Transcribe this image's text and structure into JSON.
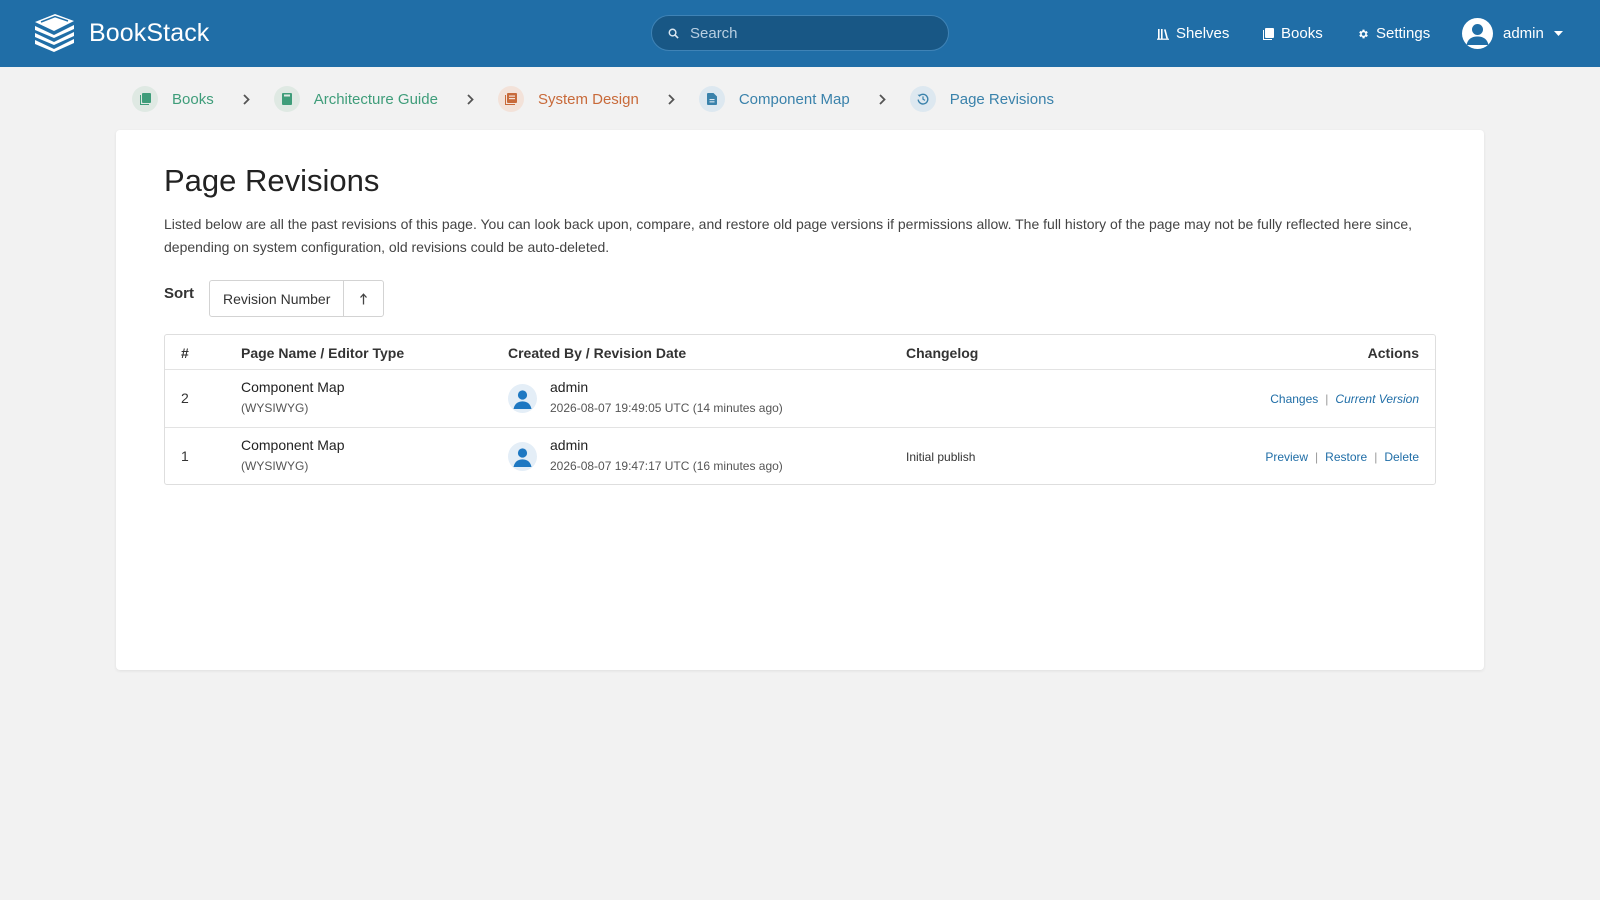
{
  "header": {
    "app_name": "BookStack",
    "search_placeholder": "Search",
    "nav": {
      "shelves": "Shelves",
      "books": "Books",
      "settings": "Settings"
    },
    "user_name": "admin"
  },
  "breadcrumbs": [
    {
      "label": "Books",
      "color": "#3f9d7a"
    },
    {
      "label": "Architecture Guide",
      "color": "#3f9d7a"
    },
    {
      "label": "System Design",
      "color": "#c86a3a"
    },
    {
      "label": "Component Map",
      "color": "#3a82ab"
    },
    {
      "label": "Page Revisions",
      "color": "#3a82ab"
    }
  ],
  "main": {
    "title": "Page Revisions",
    "intro": "Listed below are all the past revisions of this page. You can look back upon, compare, and restore old page versions if permissions allow. The full history of the page may not be fully reflected here since, depending on system configuration, old revisions could be auto-deleted.",
    "sort": {
      "label": "Sort",
      "value": "Revision Number",
      "direction": "↑"
    },
    "table": {
      "headers": {
        "num": "#",
        "name": "Page Name / Editor Type",
        "created": "Created By / Revision Date",
        "changelog": "Changelog",
        "actions": "Actions"
      },
      "rows": [
        {
          "num": "2",
          "page_name": "Component Map",
          "editor": "(WYSIWYG)",
          "user": "admin",
          "date": "2026-08-07 19:49:05 UTC (14 minutes ago)",
          "changelog": "",
          "actions": {
            "a1": "Changes",
            "a2": "Current Version"
          }
        },
        {
          "num": "1",
          "page_name": "Component Map",
          "editor": "(WYSIWYG)",
          "user": "admin",
          "date": "2026-08-07 19:47:17 UTC (16 minutes ago)",
          "changelog": "Initial publish",
          "actions": {
            "a1": "Preview",
            "a2": "Restore",
            "a3": "Delete"
          }
        }
      ]
    }
  },
  "colors": {
    "header": "#206ea7",
    "link": "#206ea7",
    "book": "#3f9d7a",
    "chapter": "#c86a3a",
    "page": "#3a82ab"
  }
}
